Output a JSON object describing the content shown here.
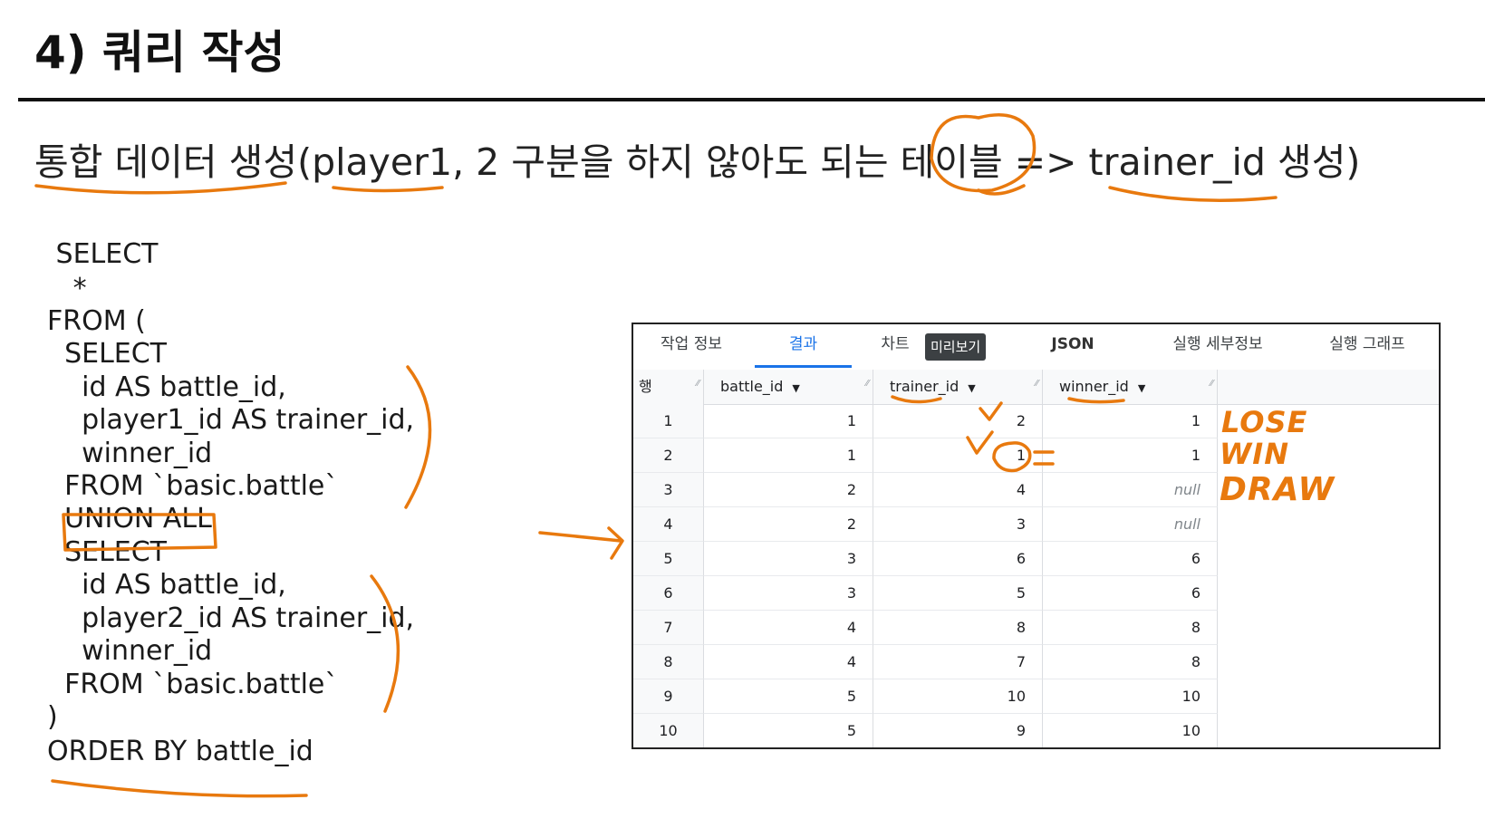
{
  "page": {
    "title": "4) 쿼리 작성",
    "subtitle": "통합 데이터 생성(player1, 2 구분을 하지 않아도 되는 테이블 => trainer_id 생성)"
  },
  "sql": {
    "lines": [
      " SELECT",
      "   *",
      "FROM (",
      "  SELECT",
      "    id AS battle_id,",
      "    player1_id AS trainer_id,",
      "    winner_id",
      "  FROM `basic.battle`",
      "  UNION ALL",
      "  SELECT",
      "    id AS battle_id,",
      "    player2_id AS trainer_id,",
      "    winner_id",
      "  FROM `basic.battle`",
      ")",
      "ORDER BY battle_id"
    ]
  },
  "results_panel": {
    "tabs": [
      "작업 정보",
      "결과",
      "차트",
      "JSON",
      "실행 세부정보",
      "실행 그래프"
    ],
    "active_tab": "결과",
    "tooltip": "미리보기",
    "columns": [
      "행",
      "battle_id",
      "trainer_id",
      "winner_id"
    ],
    "rows": [
      [
        "1",
        "1",
        "2",
        "1"
      ],
      [
        "2",
        "1",
        "1",
        "1"
      ],
      [
        "3",
        "2",
        "4",
        "null"
      ],
      [
        "4",
        "2",
        "3",
        "null"
      ],
      [
        "5",
        "3",
        "6",
        "6"
      ],
      [
        "6",
        "3",
        "5",
        "6"
      ],
      [
        "7",
        "4",
        "8",
        "8"
      ],
      [
        "8",
        "4",
        "7",
        "8"
      ],
      [
        "9",
        "5",
        "10",
        "10"
      ],
      [
        "10",
        "5",
        "9",
        "10"
      ]
    ]
  },
  "annotations": {
    "handwritten": [
      "LOSE",
      "WIN",
      "DRAW"
    ],
    "ink_color": "#e8790e"
  }
}
